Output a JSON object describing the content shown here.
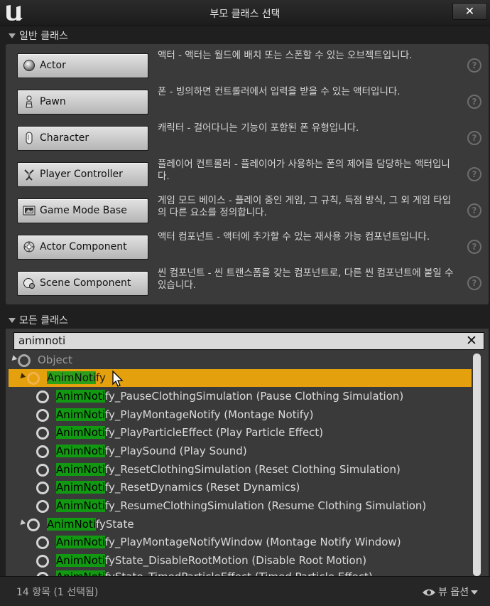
{
  "window": {
    "title": "부모 클래스 선택",
    "close_label": "✕"
  },
  "common_section": {
    "header": "일반 클래스",
    "items": [
      {
        "label": "Actor",
        "icon": "actor-sphere-icon",
        "description": "액터 - 액터는 월드에 배치 또는 스폰할 수 있는 오브젝트입니다."
      },
      {
        "label": "Pawn",
        "icon": "pawn-icon",
        "description": "폰 - 빙의하면 컨트롤러에서 입력을 받을 수 있는 액터입니다."
      },
      {
        "label": "Character",
        "icon": "character-capsule-icon",
        "description": "캐릭터 - 걸어다니는 기능이 포함된 폰 유형입니다."
      },
      {
        "label": "Player Controller",
        "icon": "player-controller-icon",
        "description": "플레이어 컨트롤러 - 플레이어가 사용하는 폰의 제어를 담당하는 액터입니다."
      },
      {
        "label": "Game Mode Base",
        "icon": "game-mode-icon",
        "description": "게임 모드 베이스 - 플레이 중인 게임, 그 규칙, 득점 방식, 그 외 게임 타입의 다른 요소를 정의합니다."
      },
      {
        "label": "Actor Component",
        "icon": "actor-component-icon",
        "description": "액터 컴포넌트 - 액터에 추가할 수 있는 재사용 가능 컴포넌트입니다."
      },
      {
        "label": "Scene Component",
        "icon": "scene-component-icon",
        "description": "씬 컴포넌트 - 씬 트랜스폼을 갖는 컴포넌트로, 다른 씬 컴포넌트에 붙일 수 있습니다."
      }
    ],
    "help_glyph": "?"
  },
  "all_section": {
    "header": "모든 클래스",
    "search_value": "animnoti",
    "clear_glyph": "✕",
    "tree": [
      {
        "match": "",
        "rest": "Object",
        "indent": 0,
        "expander": true,
        "state": "dim"
      },
      {
        "match": "AnimNoti",
        "rest": "fy",
        "indent": 1,
        "expander": true,
        "state": "selected"
      },
      {
        "match": "AnimNoti",
        "rest": "fy_PauseClothingSimulation (Pause Clothing Simulation)",
        "indent": 2
      },
      {
        "match": "AnimNoti",
        "rest": "fy_PlayMontageNotify (Montage Notify)",
        "indent": 2
      },
      {
        "match": "AnimNoti",
        "rest": "fy_PlayParticleEffect (Play Particle Effect)",
        "indent": 2
      },
      {
        "match": "AnimNoti",
        "rest": "fy_PlaySound (Play Sound)",
        "indent": 2
      },
      {
        "match": "AnimNoti",
        "rest": "fy_ResetClothingSimulation (Reset Clothing Simulation)",
        "indent": 2
      },
      {
        "match": "AnimNoti",
        "rest": "fy_ResetDynamics (Reset Dynamics)",
        "indent": 2
      },
      {
        "match": "AnimNoti",
        "rest": "fy_ResumeClothingSimulation (Resume Clothing Simulation)",
        "indent": 2
      },
      {
        "match": "AnimNoti",
        "rest": "fyState",
        "indent": 1,
        "expander": true
      },
      {
        "match": "AnimNoti",
        "rest": "fy_PlayMontageNotifyWindow (Montage Notify Window)",
        "indent": 2
      },
      {
        "match": "AnimNoti",
        "rest": "fyState_DisableRootMotion (Disable Root Motion)",
        "indent": 2
      },
      {
        "match": "AnimNoti",
        "rest": "fyState_TimedParticleEffect (Timed Particle Effect)",
        "indent": 2,
        "cut": true
      }
    ]
  },
  "footer": {
    "count_text": "14 항목 (1 선택됨)",
    "view_options_label": "뷰 옵션"
  }
}
